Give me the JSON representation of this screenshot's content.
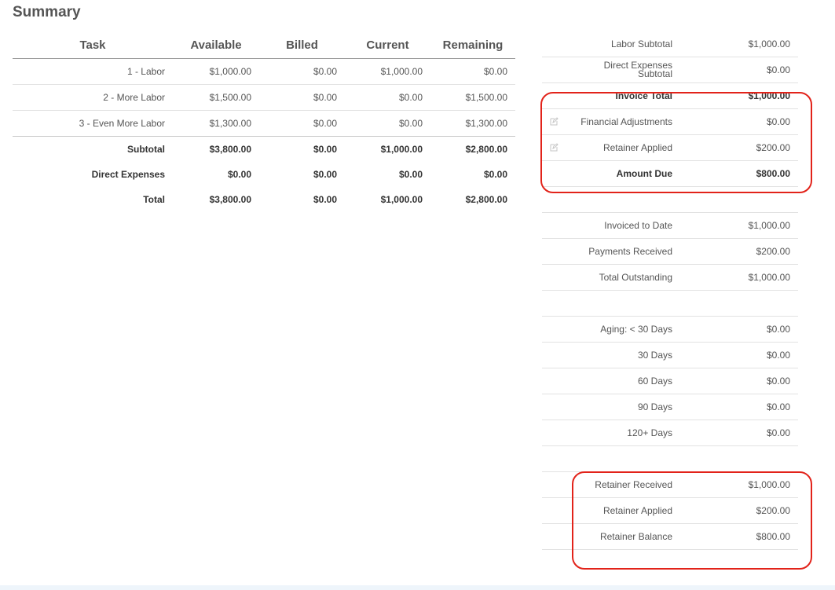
{
  "page": {
    "title": "Summary"
  },
  "task_table": {
    "headers": [
      "Task",
      "Available",
      "Billed",
      "Current",
      "Remaining"
    ],
    "rows": [
      {
        "task": "1 - Labor",
        "available": "$1,000.00",
        "billed": "$0.00",
        "current": "$1,000.00",
        "remaining": "$0.00"
      },
      {
        "task": "2 - More Labor",
        "available": "$1,500.00",
        "billed": "$0.00",
        "current": "$0.00",
        "remaining": "$1,500.00"
      },
      {
        "task": "3 - Even More Labor",
        "available": "$1,300.00",
        "billed": "$0.00",
        "current": "$0.00",
        "remaining": "$1,300.00"
      }
    ],
    "subtotal": {
      "task": "Subtotal",
      "available": "$3,800.00",
      "billed": "$0.00",
      "current": "$1,000.00",
      "remaining": "$2,800.00"
    },
    "direct_expenses": {
      "task": "Direct Expenses",
      "available": "$0.00",
      "billed": "$0.00",
      "current": "$0.00",
      "remaining": "$0.00"
    },
    "total": {
      "task": "Total",
      "available": "$3,800.00",
      "billed": "$0.00",
      "current": "$1,000.00",
      "remaining": "$2,800.00"
    }
  },
  "summary": {
    "labor_subtotal": {
      "label": "Labor Subtotal",
      "value": "$1,000.00"
    },
    "direct_expenses_subtotal": {
      "label": "Direct Expenses Subtotal",
      "value": "$0.00"
    },
    "invoice_total": {
      "label": "Invoice Total",
      "value": "$1,000.00"
    },
    "financial_adjustments": {
      "label": "Financial Adjustments",
      "value": "$0.00"
    },
    "retainer_applied": {
      "label": "Retainer Applied",
      "value": "$200.00"
    },
    "amount_due": {
      "label": "Amount Due",
      "value": "$800.00"
    },
    "invoiced_to_date": {
      "label": "Invoiced to Date",
      "value": "$1,000.00"
    },
    "payments_received": {
      "label": "Payments Received",
      "value": "$200.00"
    },
    "total_outstanding": {
      "label": "Total Outstanding",
      "value": "$1,000.00"
    },
    "aging_30": {
      "label": "Aging: < 30 Days",
      "value": "$0.00"
    },
    "days_30": {
      "label": "30 Days",
      "value": "$0.00"
    },
    "days_60": {
      "label": "60 Days",
      "value": "$0.00"
    },
    "days_90": {
      "label": "90 Days",
      "value": "$0.00"
    },
    "days_120": {
      "label": "120+ Days",
      "value": "$0.00"
    },
    "retainer_received": {
      "label": "Retainer Received",
      "value": "$1,000.00"
    },
    "retainer_applied_2": {
      "label": "Retainer Applied",
      "value": "$200.00"
    },
    "retainer_balance": {
      "label": "Retainer Balance",
      "value": "$800.00"
    }
  },
  "colors": {
    "highlight": "#e2231a",
    "text": "#555555"
  },
  "icons": {
    "edit": "edit-icon"
  }
}
